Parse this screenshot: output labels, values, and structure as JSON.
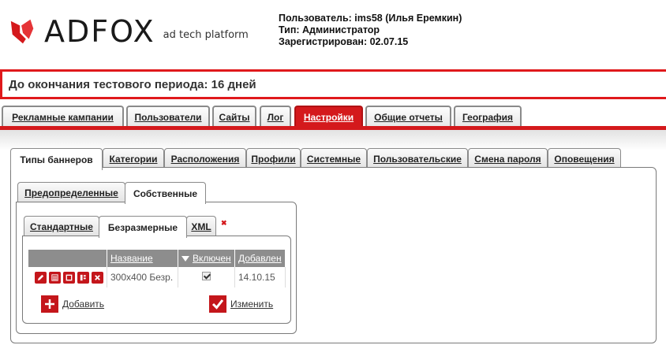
{
  "brand": {
    "name": "ADFOX",
    "tagline": "ad tech platform",
    "accent": "#d4191c"
  },
  "user": {
    "user_line": "Пользователь:  ims58 (Илья Еремкин)",
    "type_line": "Тип:  Администратор",
    "registered_line": "Зарегистрирован:  02.07.15"
  },
  "trial_banner": "До окончания тестового периода: 16 дней",
  "main_nav": [
    {
      "label": "Рекламные кампании"
    },
    {
      "label": "Пользователи"
    },
    {
      "label": "Сайты"
    },
    {
      "label": "Лог"
    },
    {
      "label": "Настройки",
      "active": true
    },
    {
      "label": "Общие отчеты"
    },
    {
      "label": "География"
    }
  ],
  "settings_tabs": [
    {
      "label": "Типы баннеров",
      "active": true
    },
    {
      "label": "Категории"
    },
    {
      "label": "Расположения"
    },
    {
      "label": "Профили"
    },
    {
      "label": "Системные"
    },
    {
      "label": "Пользовательские"
    },
    {
      "label": "Смена пароля"
    },
    {
      "label": "Оповещения"
    }
  ],
  "banner_group_tabs": [
    {
      "label": "Предопределенные"
    },
    {
      "label": "Собственные",
      "active": true
    }
  ],
  "banner_kind_tabs": [
    {
      "label": "Стандартные"
    },
    {
      "label": "Безразмерные",
      "active": true
    },
    {
      "label": "XML"
    }
  ],
  "table": {
    "columns": [
      "Название",
      "Включен",
      "Добавлен"
    ],
    "rows": [
      {
        "name": "300x400 Безр.",
        "enabled": true,
        "added": "14.10.15"
      }
    ]
  },
  "actions": {
    "add_label": "Добавить",
    "edit_label": "Изменить"
  }
}
